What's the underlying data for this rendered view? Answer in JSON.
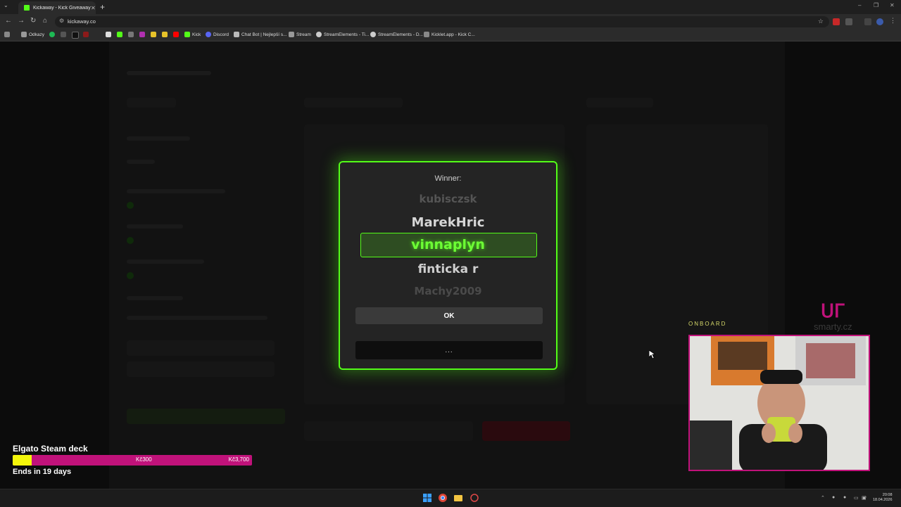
{
  "browser": {
    "tab_title": "Kickaway - Kick Giveaway Tool",
    "url": "kickaway.co",
    "bookmarks": [
      {
        "label": "Odkazy",
        "icon": "folder-icon"
      },
      {
        "label": "Kick",
        "icon": "kick-icon"
      },
      {
        "label": "Discord",
        "icon": "discord-icon"
      },
      {
        "label": "Chat Bot | Nejlepší s...",
        "icon": "chatbot-icon"
      },
      {
        "label": "Stream",
        "icon": "folder-icon"
      },
      {
        "label": "StreamElements - Ti...",
        "icon": "streamelements-icon"
      },
      {
        "label": "StreamElements - D...",
        "icon": "streamelements-icon"
      },
      {
        "label": "Kicklet.app - Kick C...",
        "icon": "kicklet-icon"
      }
    ]
  },
  "modal": {
    "label": "Winner:",
    "names": [
      "kubisczsk",
      "MarekHric",
      "vinnaplyn",
      "finticka r",
      "Machy2009"
    ],
    "winner": "vinnaplyn",
    "ok_label": "OK",
    "dots_label": "...",
    "accent": "#53fc18"
  },
  "goal": {
    "title": "Elgato Steam deck",
    "current": "Kč300",
    "target": "Kč3,700",
    "progress": 0.08,
    "ends": "Ends in 19 days",
    "bar_color": "#c0127a",
    "fill_color": "#f4f60a"
  },
  "webcam": {
    "label": "ONBOARD",
    "sponsor": "smarty.cz"
  },
  "taskbar": {
    "time": "20:08",
    "date": "18.04.2026"
  }
}
